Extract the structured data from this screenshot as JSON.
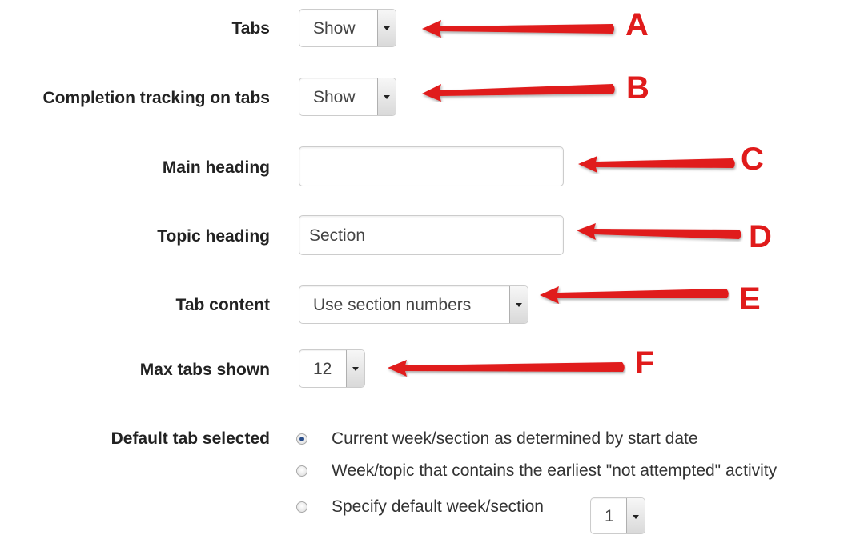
{
  "form": {
    "tabs": {
      "label": "Tabs",
      "value": "Show",
      "annotation": "A"
    },
    "completion_tracking": {
      "label": "Completion tracking on tabs",
      "value": "Show",
      "annotation": "B"
    },
    "main_heading": {
      "label": "Main heading",
      "value": "",
      "annotation": "C"
    },
    "topic_heading": {
      "label": "Topic heading",
      "value": "Section",
      "annotation": "D"
    },
    "tab_content": {
      "label": "Tab content",
      "value": "Use section numbers",
      "annotation": "E"
    },
    "max_tabs": {
      "label": "Max tabs shown",
      "value": "12",
      "annotation": "F"
    },
    "default_tab": {
      "label": "Default tab selected",
      "selected_option": 0,
      "options": [
        "Current week/section as determined by start date",
        "Week/topic that contains the earliest \"not attempted\" activity",
        "Specify default week/section"
      ],
      "default_section_value": "1"
    }
  },
  "colors": {
    "annotation": "#e01b1b",
    "label": "#222222",
    "input_border": "#cccccc"
  }
}
